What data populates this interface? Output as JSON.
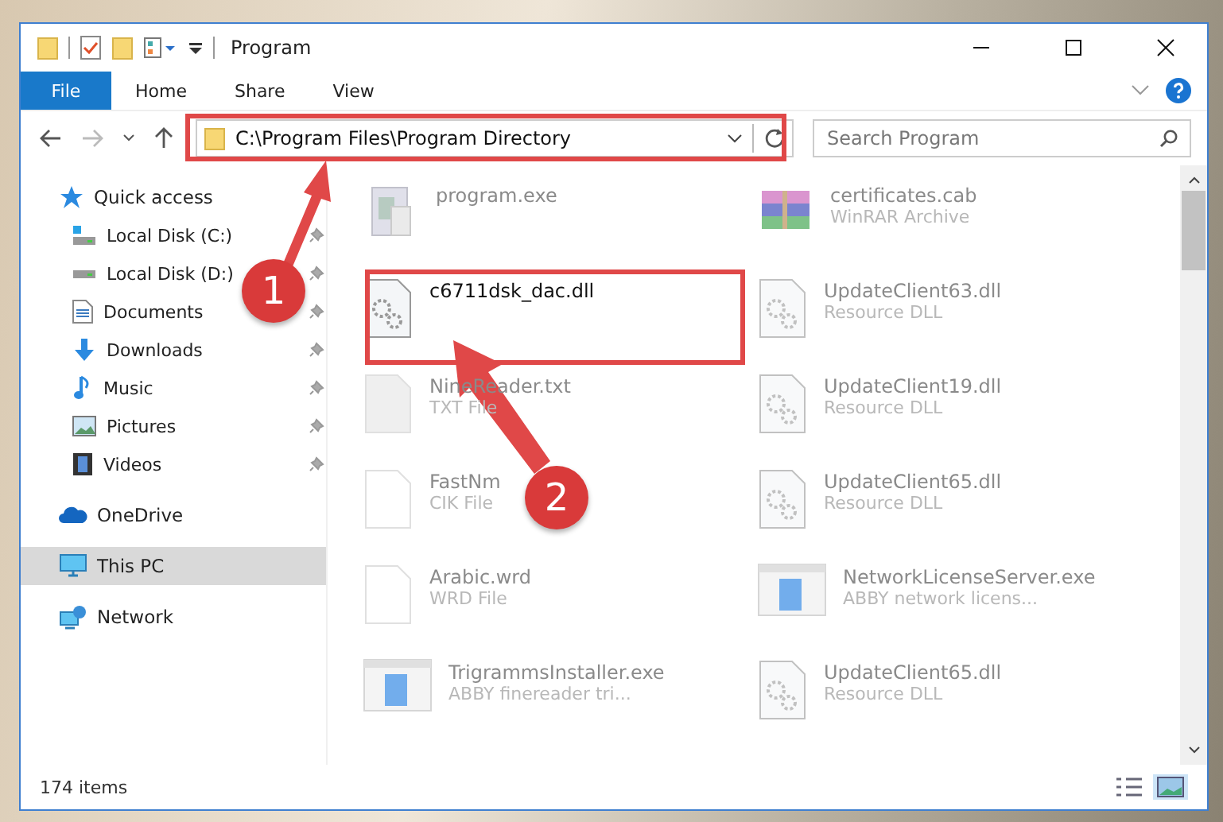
{
  "window": {
    "title": "Program"
  },
  "ribbon_tabs": [
    {
      "label": "File",
      "kind": "menu"
    },
    {
      "label": "Home",
      "kind": "tab"
    },
    {
      "label": "Share",
      "kind": "tab"
    },
    {
      "label": "View",
      "kind": "tab"
    }
  ],
  "address_bar": {
    "path": "C:\\Program Files\\Program Directory"
  },
  "search": {
    "placeholder": "Search Program"
  },
  "sidebar": {
    "items": [
      {
        "label": "Quick access",
        "kind": "star",
        "selected": false,
        "children": [
          {
            "label": "Local Disk (C:)",
            "kind": "drive-c",
            "pinned": true,
            "selected": false
          },
          {
            "label": "Local Disk (D:)",
            "kind": "drive",
            "pinned": true,
            "selected": false
          },
          {
            "label": "Documents",
            "kind": "documents",
            "pinned": true,
            "selected": false
          },
          {
            "label": "Downloads",
            "kind": "downloads",
            "pinned": true,
            "selected": false
          },
          {
            "label": "Music",
            "kind": "music",
            "pinned": true,
            "selected": false
          },
          {
            "label": "Pictures",
            "kind": "pictures",
            "pinned": true,
            "selected": false
          },
          {
            "label": "Videos",
            "kind": "videos",
            "pinned": true,
            "selected": false
          }
        ]
      },
      {
        "label": "OneDrive",
        "kind": "cloud",
        "selected": false
      },
      {
        "label": "This PC",
        "kind": "pc",
        "selected": true
      },
      {
        "label": "Network",
        "kind": "network",
        "selected": false
      }
    ]
  },
  "files": [
    {
      "name": "program.exe",
      "kind": "exe",
      "blurred": true
    },
    {
      "name": "certificates.cab",
      "type": "WinRAR Archive",
      "kind": "archive",
      "blurred": true
    },
    {
      "name": "c6711dsk_dac.dll",
      "kind": "dll",
      "blurred": false
    },
    {
      "name": "UpdateClient63.dll",
      "type": "Resource DLL",
      "kind": "dll",
      "blurred": true
    },
    {
      "name": "NineReader.txt",
      "type": "TXT File",
      "kind": "txt",
      "blurred": true
    },
    {
      "name": "UpdateClient19.dll",
      "type": "Resource DLL",
      "kind": "dll",
      "blurred": true
    },
    {
      "name": "FastNm",
      "type": "CIK File",
      "kind": "blank",
      "blurred": true
    },
    {
      "name": "UpdateClient65.dll",
      "type": "Resource DLL",
      "kind": "dll",
      "blurred": true
    },
    {
      "name": "Arabic.wrd",
      "type": "WRD File",
      "kind": "blank",
      "blurred": true
    },
    {
      "name": "NetworkLicenseServer.exe",
      "type": "ABBY network licens...",
      "kind": "app",
      "blurred": true
    },
    {
      "name": "TrigrammsInstaller.exe",
      "type": "ABBY finereader tri...",
      "kind": "app",
      "blurred": true
    },
    {
      "name": "UpdateClient65.dll",
      "type": "Resource DLL",
      "kind": "dll",
      "blurred": true
    }
  ],
  "status_bar": {
    "item_count": "174 items",
    "views": [
      {
        "kind": "details",
        "selected": false
      },
      {
        "kind": "large-icons",
        "selected": true
      }
    ]
  },
  "annotations": [
    {
      "label": "1"
    },
    {
      "label": "2"
    }
  ]
}
